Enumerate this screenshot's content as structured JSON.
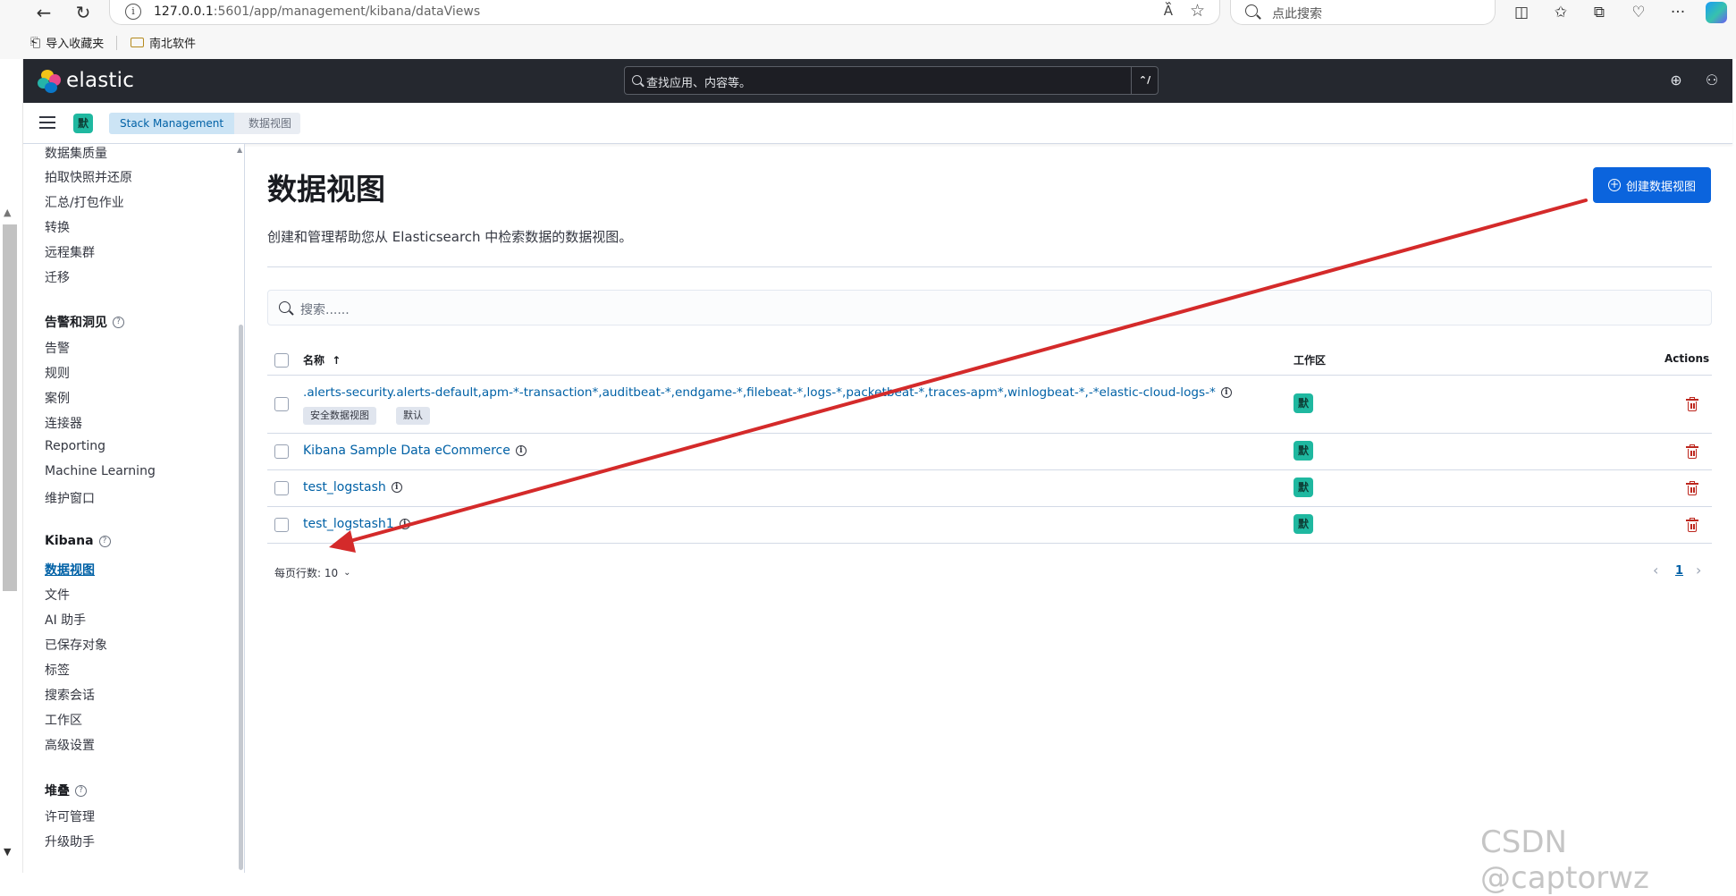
{
  "browser": {
    "url_host": "127.0.0.1",
    "url_rest": ":5601/app/management/kibana/dataViews",
    "search_placeholder": "点此搜索",
    "bookmarks": [
      {
        "label": "导入收藏夹"
      },
      {
        "label": "南北软件"
      }
    ]
  },
  "header": {
    "brand": "elastic",
    "search_placeholder": "查找应用、内容等。",
    "search_shortcut": "⌃/"
  },
  "breadcrumb": {
    "space_initial": "默",
    "items": [
      "Stack Management",
      "数据视图"
    ]
  },
  "sidebar": {
    "top_items": [
      "数据集质量",
      "拍取快照并还原",
      "汇总/打包作业",
      "转换",
      "远程集群",
      "迁移"
    ],
    "sections": [
      {
        "title": "告警和洞见",
        "items": [
          "告警",
          "规则",
          "案例",
          "连接器",
          "Reporting",
          "Machine Learning",
          "维护窗口"
        ]
      },
      {
        "title": "Kibana",
        "items": [
          "数据视图",
          "文件",
          "AI 助手",
          "已保存对象",
          "标签",
          "搜索会话",
          "工作区",
          "高级设置"
        ]
      },
      {
        "title": "堆叠",
        "items": [
          "许可管理",
          "升级助手"
        ]
      }
    ],
    "active_item": "数据视图"
  },
  "main": {
    "title": "数据视图",
    "description": "创建和管理帮助您从 Elasticsearch 中检索数据的数据视图。",
    "create_button": "创建数据视图",
    "search_placeholder": "搜索......",
    "columns": {
      "name": "名称",
      "sort_indicator": "↑",
      "workspace": "工作区",
      "actions": "Actions"
    },
    "rows": [
      {
        "name": ".alerts-security.alerts-default,apm-*-transaction*,auditbeat-*,endgame-*,filebeat-*,logs-*,packetbeat-*,traces-apm*,winlogbeat-*,-*elastic-cloud-logs-*",
        "badges": [
          "安全数据视图",
          "默认"
        ],
        "workspace": "默"
      },
      {
        "name": "Kibana Sample Data eCommerce",
        "badges": [],
        "workspace": "默"
      },
      {
        "name": "test_logstash",
        "badges": [],
        "workspace": "默"
      },
      {
        "name": "test_logstash1",
        "badges": [],
        "workspace": "默"
      }
    ],
    "rows_per_page": "每页行数: 10",
    "current_page": "1"
  },
  "watermark": "CSDN @captorwz",
  "colors": {
    "primary": "#0b64dd",
    "link": "#0061a6",
    "danger": "#bd271e",
    "space": "#1fb8a0",
    "annotation_arrow": "#d42a2a"
  }
}
